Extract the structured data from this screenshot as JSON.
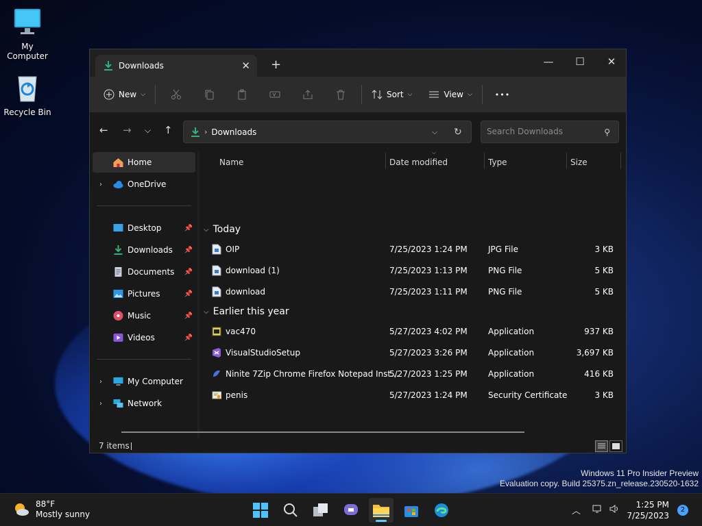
{
  "desktop": {
    "icons": [
      {
        "label": "My Computer"
      },
      {
        "label": "Recycle Bin"
      }
    ],
    "watermark": {
      "line1": "Windows 11 Pro Insider Preview",
      "line2": "Evaluation copy. Build 25375.zn_release.230520-1632"
    }
  },
  "window": {
    "tab_title": "Downloads",
    "toolbar": {
      "new_label": "New",
      "sort_label": "Sort",
      "view_label": "View",
      "more_label": "•••"
    },
    "address": {
      "path": "Downloads",
      "search_placeholder": "Search Downloads"
    },
    "sidebar": {
      "items": [
        {
          "label": "Home",
          "icon": "home-icon"
        },
        {
          "label": "OneDrive",
          "icon": "cloud-icon"
        },
        {
          "label": "Desktop",
          "icon": "desktop-folder-icon"
        },
        {
          "label": "Downloads",
          "icon": "download-icon"
        },
        {
          "label": "Documents",
          "icon": "documents-icon"
        },
        {
          "label": "Pictures",
          "icon": "pictures-icon"
        },
        {
          "label": "Music",
          "icon": "music-icon"
        },
        {
          "label": "Videos",
          "icon": "videos-icon"
        },
        {
          "label": "My Computer",
          "icon": "computer-icon"
        },
        {
          "label": "Network",
          "icon": "network-icon"
        }
      ]
    },
    "columns": {
      "name": "Name",
      "date": "Date modified",
      "type": "Type",
      "size": "Size"
    },
    "groups": [
      {
        "label": "Today",
        "files": [
          {
            "name": "OIP",
            "date": "7/25/2023 1:24 PM",
            "type": "JPG File",
            "size": "3 KB"
          },
          {
            "name": "download (1)",
            "date": "7/25/2023 1:13 PM",
            "type": "PNG File",
            "size": "5 KB"
          },
          {
            "name": "download",
            "date": "7/25/2023 1:11 PM",
            "type": "PNG File",
            "size": "5 KB"
          }
        ]
      },
      {
        "label": "Earlier this year",
        "files": [
          {
            "name": "vac470",
            "date": "5/27/2023 4:02 PM",
            "type": "Application",
            "size": "937 KB"
          },
          {
            "name": "VisualStudioSetup",
            "date": "5/27/2023 3:26 PM",
            "type": "Application",
            "size": "3,697 KB"
          },
          {
            "name": "Ninite 7Zip Chrome Firefox Notepad Inst...",
            "date": "5/27/2023 1:25 PM",
            "type": "Application",
            "size": "416 KB"
          },
          {
            "name": "penis",
            "date": "5/27/2023 1:24 PM",
            "type": "Security Certificate",
            "size": "3 KB"
          }
        ]
      }
    ],
    "status": {
      "count": "7 items"
    }
  },
  "taskbar": {
    "weather": {
      "temp": "88°F",
      "condition": "Mostly sunny"
    },
    "clock": {
      "time": "1:25 PM",
      "date": "7/25/2023"
    },
    "notifications": "2"
  },
  "colors": {
    "accent": "#60cdff",
    "download_green": "#2fb37a",
    "folder_yellow": "#f3c13a"
  }
}
